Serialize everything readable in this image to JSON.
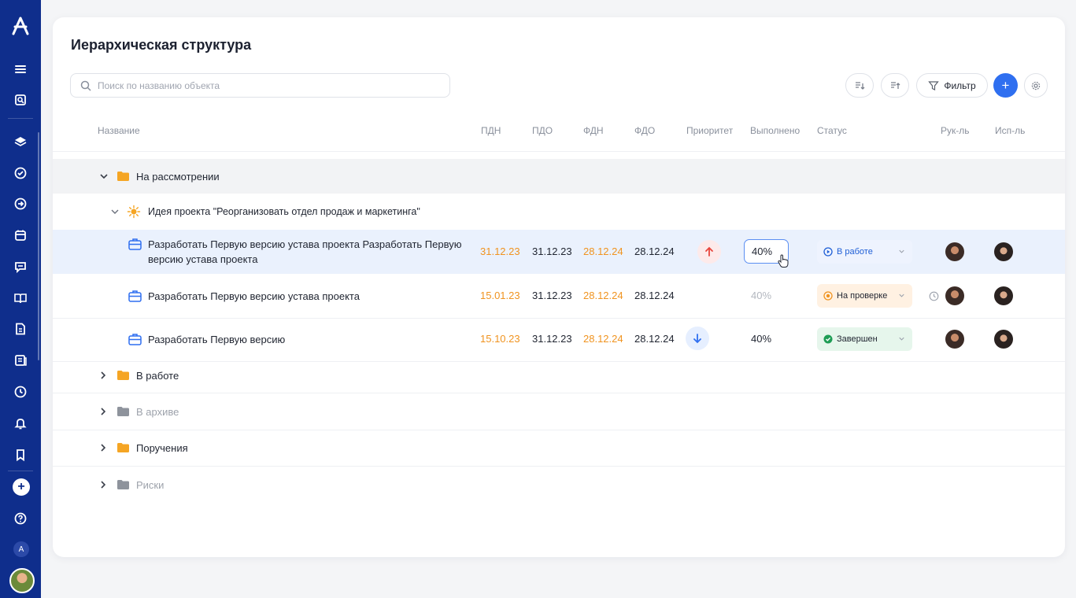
{
  "brand": {
    "logo_letter": "A",
    "mini_logo_letter": "A"
  },
  "sidebar": {
    "items": [
      {
        "icon": "menu-icon"
      },
      {
        "icon": "search-doc-icon"
      },
      {
        "icon": "layers-icon"
      },
      {
        "icon": "check-circle-icon"
      },
      {
        "icon": "arrow-circle-icon"
      },
      {
        "icon": "calendar-icon"
      },
      {
        "icon": "chat-icon"
      },
      {
        "icon": "book-icon"
      },
      {
        "icon": "document-icon"
      },
      {
        "icon": "news-icon"
      },
      {
        "icon": "clock-icon"
      },
      {
        "icon": "bell-icon"
      },
      {
        "icon": "bookmark-icon"
      },
      {
        "icon": "plus-icon"
      },
      {
        "icon": "help-icon"
      }
    ]
  },
  "page": {
    "title": "Иерархическая структура"
  },
  "search": {
    "placeholder": "Поиск по названию объекта"
  },
  "toolbar": {
    "filter_label": "Фильтр",
    "add_label": "+"
  },
  "columns": {
    "name": "Название",
    "pdn": "ПДН",
    "pdo": "ПДО",
    "fdn": "ФДН",
    "fdo": "ФДО",
    "priority": "Приоритет",
    "done": "Выполнено",
    "status": "Статус",
    "manager": "Рук-ль",
    "executor": "Исп-ль"
  },
  "groups": {
    "review": "На рассмотрении",
    "in_work": "В работе",
    "archive": "В архиве",
    "orders": "Поручения",
    "risks": "Риски"
  },
  "project": {
    "title": "Идея проекта \"Реорганизовать отдел продаж и маркетинга\""
  },
  "tasks": [
    {
      "name": "Разработать Первую версию устава проекта Разработать Первую версию устава проекта",
      "pdn": "31.12.23",
      "pdo": "31.12.23",
      "fdn": "28.12.24",
      "fdo": "28.12.24",
      "priority": "up",
      "done": "40%",
      "status": "В работе"
    },
    {
      "name": "Разработать Первую версию устава проекта",
      "pdn": "15.01.23",
      "pdo": "31.12.23",
      "fdn": "28.12.24",
      "fdo": "28.12.24",
      "priority": "none",
      "done": "40%",
      "status": "На проверке"
    },
    {
      "name": "Разработать Первую версию",
      "pdn": "15.10.23",
      "pdo": "31.12.23",
      "fdn": "28.12.24",
      "fdo": "28.12.24",
      "priority": "down",
      "done": "40%",
      "status": "Завершен"
    }
  ],
  "colors": {
    "sidebar": "#0f2e8c",
    "accent": "#2f6ff0",
    "folder_active": "#f5a524",
    "folder_inactive": "#8e939c",
    "date_warning": "#f0931f",
    "priority_high": "#e8453c",
    "status_in_work": "#1f5fd6",
    "status_review": "#f0931f",
    "status_done": "#1f9d55"
  }
}
